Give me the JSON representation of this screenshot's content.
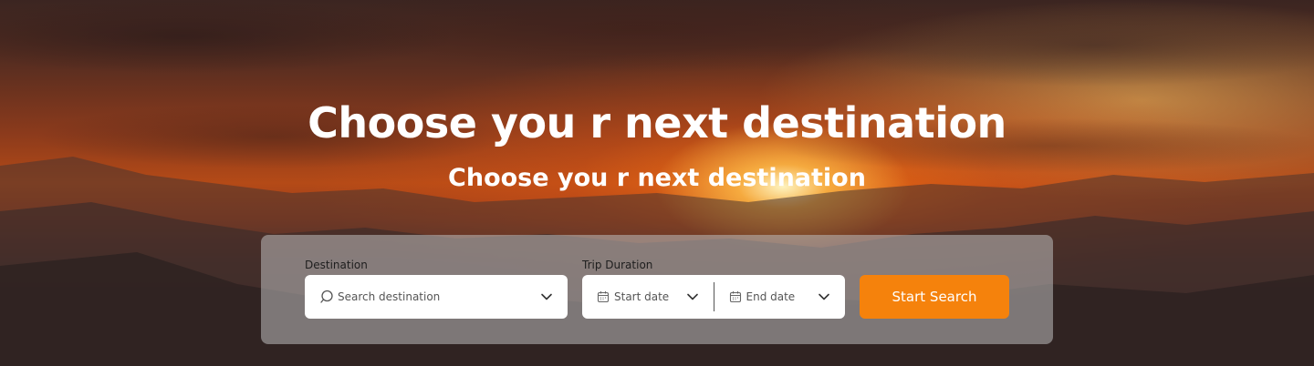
{
  "hero": {
    "title": "Choose you r next destination",
    "subtitle": "Choose you r next destination"
  },
  "search": {
    "destination_label": "Destination",
    "destination_placeholder": "Search destination",
    "trip_duration_label": "Trip Duration",
    "start_date_placeholder": "Start date",
    "end_date_placeholder": "End date",
    "button_label": "Start Search"
  },
  "colors": {
    "accent": "#f5820c",
    "panel": "rgba(190,190,190,0.55)",
    "text_light": "#ffffff"
  },
  "icons": [
    "search-icon",
    "chevron-down-icon",
    "calendar-icon"
  ]
}
